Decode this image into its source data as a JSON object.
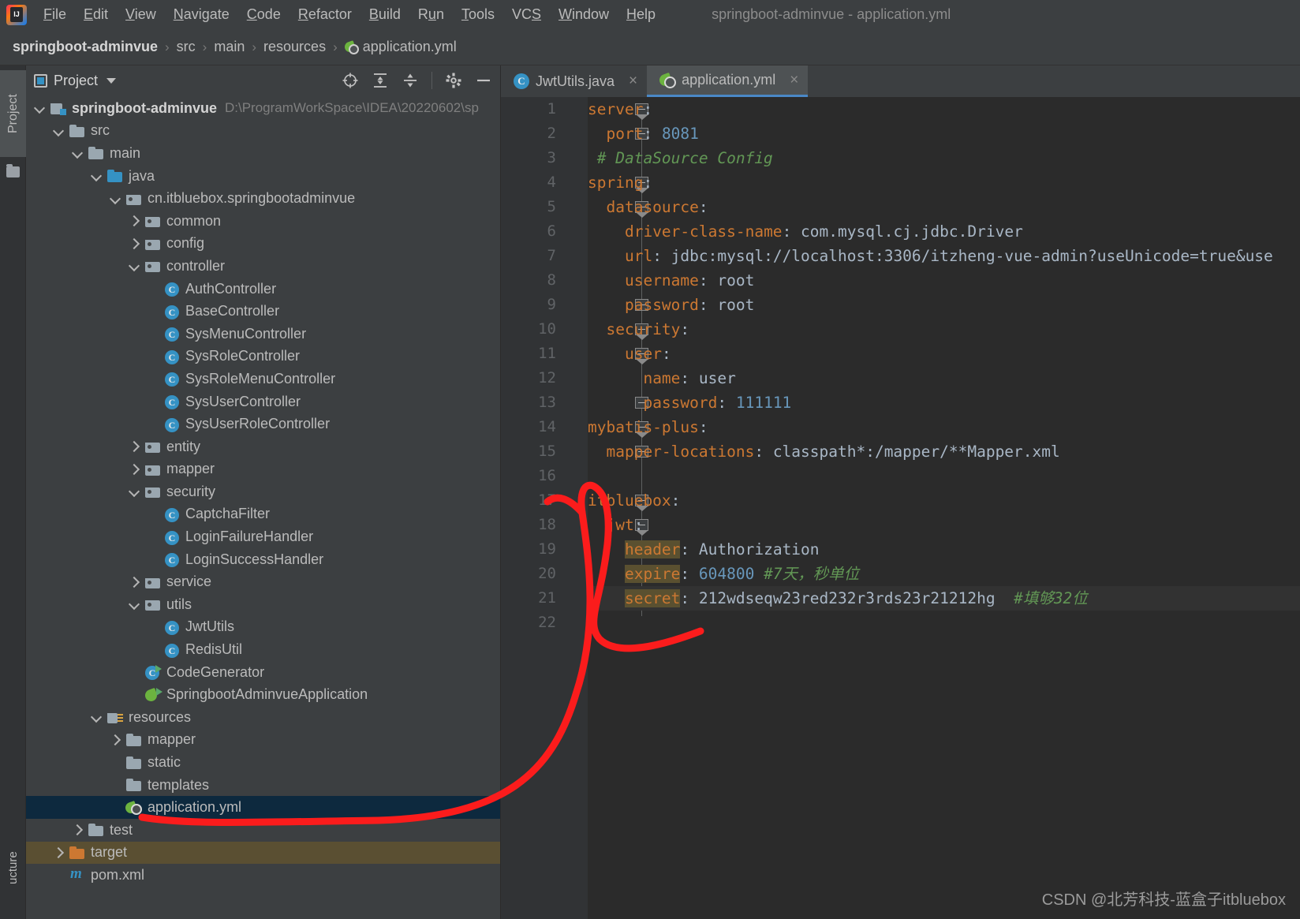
{
  "window": {
    "title": "springboot-adminvue - application.yml",
    "logo_icon": "intellij-idea-logo"
  },
  "menubar": {
    "items": [
      {
        "label": "File",
        "mnemonic": "F"
      },
      {
        "label": "Edit",
        "mnemonic": "E"
      },
      {
        "label": "View",
        "mnemonic": "V"
      },
      {
        "label": "Navigate",
        "mnemonic": "N"
      },
      {
        "label": "Code",
        "mnemonic": "C"
      },
      {
        "label": "Refactor",
        "mnemonic": "R"
      },
      {
        "label": "Build",
        "mnemonic": "B"
      },
      {
        "label": "Run",
        "mnemonic": "u"
      },
      {
        "label": "Tools",
        "mnemonic": "T"
      },
      {
        "label": "VCS",
        "mnemonic": "S"
      },
      {
        "label": "Window",
        "mnemonic": "W"
      },
      {
        "label": "Help",
        "mnemonic": "H"
      }
    ]
  },
  "breadcrumb": {
    "separator": "›",
    "items": [
      "springboot-adminvue",
      "src",
      "main",
      "resources",
      "application.yml"
    ],
    "file_icon": "yaml-spring-icon"
  },
  "left_strip": {
    "project_tab": "Project",
    "bottom_tab": "ucture",
    "folder_icon": "folder-icon"
  },
  "project_panel": {
    "title": "Project",
    "dropdown_icon": "chevron-down-icon",
    "toolbar_icons": [
      "select-opened-file-icon",
      "expand-all-icon",
      "collapse-all-icon",
      "settings-gear-icon",
      "hide-panel-icon"
    ],
    "tree": [
      {
        "label": "springboot-adminvue",
        "path": "D:\\ProgramWorkSpace\\IDEA\\20220602\\sp",
        "depth": 0,
        "arrow": "open",
        "icon": "module-root-icon",
        "bold": true
      },
      {
        "label": "src",
        "depth": 1,
        "arrow": "open",
        "icon": "folder-icon"
      },
      {
        "label": "main",
        "depth": 2,
        "arrow": "open",
        "icon": "folder-icon"
      },
      {
        "label": "java",
        "depth": 3,
        "arrow": "open",
        "icon": "source-root-folder-icon"
      },
      {
        "label": "cn.itbluebox.springbootadminvue",
        "depth": 4,
        "arrow": "open",
        "icon": "package-icon"
      },
      {
        "label": "common",
        "depth": 5,
        "arrow": "closed",
        "icon": "package-icon"
      },
      {
        "label": "config",
        "depth": 5,
        "arrow": "closed",
        "icon": "package-icon"
      },
      {
        "label": "controller",
        "depth": 5,
        "arrow": "open",
        "icon": "package-icon"
      },
      {
        "label": "AuthController",
        "depth": 6,
        "arrow": "none",
        "icon": "java-class-icon"
      },
      {
        "label": "BaseController",
        "depth": 6,
        "arrow": "none",
        "icon": "java-class-icon"
      },
      {
        "label": "SysMenuController",
        "depth": 6,
        "arrow": "none",
        "icon": "java-class-icon"
      },
      {
        "label": "SysRoleController",
        "depth": 6,
        "arrow": "none",
        "icon": "java-class-icon"
      },
      {
        "label": "SysRoleMenuController",
        "depth": 6,
        "arrow": "none",
        "icon": "java-class-icon"
      },
      {
        "label": "SysUserController",
        "depth": 6,
        "arrow": "none",
        "icon": "java-class-icon"
      },
      {
        "label": "SysUserRoleController",
        "depth": 6,
        "arrow": "none",
        "icon": "java-class-icon"
      },
      {
        "label": "entity",
        "depth": 5,
        "arrow": "closed",
        "icon": "package-icon"
      },
      {
        "label": "mapper",
        "depth": 5,
        "arrow": "closed",
        "icon": "package-icon"
      },
      {
        "label": "security",
        "depth": 5,
        "arrow": "open",
        "icon": "package-icon"
      },
      {
        "label": "CaptchaFilter",
        "depth": 6,
        "arrow": "none",
        "icon": "java-class-icon"
      },
      {
        "label": "LoginFailureHandler",
        "depth": 6,
        "arrow": "none",
        "icon": "java-class-icon"
      },
      {
        "label": "LoginSuccessHandler",
        "depth": 6,
        "arrow": "none",
        "icon": "java-class-icon"
      },
      {
        "label": "service",
        "depth": 5,
        "arrow": "closed",
        "icon": "package-icon"
      },
      {
        "label": "utils",
        "depth": 5,
        "arrow": "open",
        "icon": "package-icon"
      },
      {
        "label": "JwtUtils",
        "depth": 6,
        "arrow": "none",
        "icon": "java-class-icon"
      },
      {
        "label": "RedisUtil",
        "depth": 6,
        "arrow": "none",
        "icon": "java-class-icon"
      },
      {
        "label": "CodeGenerator",
        "depth": 5,
        "arrow": "none",
        "icon": "runnable-class-icon"
      },
      {
        "label": "SpringbootAdminvueApplication",
        "depth": 5,
        "arrow": "none",
        "icon": "spring-boot-runnable-icon"
      },
      {
        "label": "resources",
        "depth": 3,
        "arrow": "open",
        "icon": "resource-root-folder-icon"
      },
      {
        "label": "mapper",
        "depth": 4,
        "arrow": "closed",
        "icon": "folder-icon"
      },
      {
        "label": "static",
        "depth": 4,
        "arrow": "none",
        "icon": "folder-icon"
      },
      {
        "label": "templates",
        "depth": 4,
        "arrow": "none",
        "icon": "folder-icon"
      },
      {
        "label": "application.yml",
        "depth": 4,
        "arrow": "none",
        "icon": "yaml-spring-icon",
        "state": "selected"
      },
      {
        "label": "test",
        "depth": 2,
        "arrow": "closed",
        "icon": "folder-icon"
      },
      {
        "label": "target",
        "depth": 1,
        "arrow": "closed",
        "icon": "folder-excluded-icon",
        "state": "highlight"
      },
      {
        "label": "pom.xml",
        "depth": 1,
        "arrow": "none",
        "icon": "maven-icon"
      }
    ]
  },
  "editor": {
    "tabs": [
      {
        "label": "JwtUtils.java",
        "icon": "java-class-icon",
        "active": false,
        "close": "×"
      },
      {
        "label": "application.yml",
        "icon": "yaml-spring-icon",
        "active": true,
        "close": "×"
      }
    ],
    "file_name": "application.yml",
    "lines": [
      {
        "num": 1,
        "fold": "down",
        "tokens": [
          {
            "t": "server",
            "c": "k-key"
          },
          {
            "t": ":",
            "c": "k-pun"
          }
        ]
      },
      {
        "num": 2,
        "fold": "end",
        "tokens": [
          {
            "t": "  ",
            "c": "k-pun"
          },
          {
            "t": "port",
            "c": "k-key"
          },
          {
            "t": ": ",
            "c": "k-pun"
          },
          {
            "t": "8081",
            "c": "k-num"
          }
        ]
      },
      {
        "num": 3,
        "fold": "",
        "tokens": [
          {
            "t": " # DataSource Config",
            "c": "k-com"
          }
        ]
      },
      {
        "num": 4,
        "fold": "down",
        "tokens": [
          {
            "t": "spring",
            "c": "k-key"
          },
          {
            "t": ":",
            "c": "k-pun"
          }
        ]
      },
      {
        "num": 5,
        "fold": "down",
        "tokens": [
          {
            "t": "  ",
            "c": "k-pun"
          },
          {
            "t": "datasource",
            "c": "k-key"
          },
          {
            "t": ":",
            "c": "k-pun"
          }
        ]
      },
      {
        "num": 6,
        "fold": "",
        "tokens": [
          {
            "t": "    ",
            "c": "k-pun"
          },
          {
            "t": "driver-class-name",
            "c": "k-key"
          },
          {
            "t": ": ",
            "c": "k-pun"
          },
          {
            "t": "com.mysql.cj.jdbc.Driver",
            "c": "k-str"
          }
        ]
      },
      {
        "num": 7,
        "fold": "",
        "tokens": [
          {
            "t": "    ",
            "c": "k-pun"
          },
          {
            "t": "url",
            "c": "k-key"
          },
          {
            "t": ": ",
            "c": "k-pun"
          },
          {
            "t": "jdbc:mysql://localhost:3306/itzheng-vue-admin?useUnicode=true&use",
            "c": "k-str"
          }
        ]
      },
      {
        "num": 8,
        "fold": "",
        "tokens": [
          {
            "t": "    ",
            "c": "k-pun"
          },
          {
            "t": "username",
            "c": "k-key"
          },
          {
            "t": ": ",
            "c": "k-pun"
          },
          {
            "t": "root",
            "c": "k-str"
          }
        ]
      },
      {
        "num": 9,
        "fold": "end",
        "tokens": [
          {
            "t": "    ",
            "c": "k-pun"
          },
          {
            "t": "password",
            "c": "k-key"
          },
          {
            "t": ": ",
            "c": "k-pun"
          },
          {
            "t": "root",
            "c": "k-str"
          }
        ]
      },
      {
        "num": 10,
        "fold": "down",
        "tokens": [
          {
            "t": "  ",
            "c": "k-pun"
          },
          {
            "t": "security",
            "c": "k-key"
          },
          {
            "t": ":",
            "c": "k-pun"
          }
        ]
      },
      {
        "num": 11,
        "fold": "down",
        "tokens": [
          {
            "t": "    ",
            "c": "k-pun"
          },
          {
            "t": "user",
            "c": "k-key"
          },
          {
            "t": ":",
            "c": "k-pun"
          }
        ]
      },
      {
        "num": 12,
        "fold": "",
        "tokens": [
          {
            "t": "      ",
            "c": "k-pun"
          },
          {
            "t": "name",
            "c": "k-key"
          },
          {
            "t": ": ",
            "c": "k-pun"
          },
          {
            "t": "user",
            "c": "k-str"
          }
        ]
      },
      {
        "num": 13,
        "fold": "end",
        "tokens": [
          {
            "t": "      ",
            "c": "k-pun"
          },
          {
            "t": "password",
            "c": "k-key"
          },
          {
            "t": ": ",
            "c": "k-pun"
          },
          {
            "t": "111111",
            "c": "k-num"
          }
        ]
      },
      {
        "num": 14,
        "fold": "down",
        "tokens": [
          {
            "t": "mybatis-plus",
            "c": "k-key"
          },
          {
            "t": ":",
            "c": "k-pun"
          }
        ]
      },
      {
        "num": 15,
        "fold": "end",
        "tokens": [
          {
            "t": "  ",
            "c": "k-pun"
          },
          {
            "t": "mapper-locations",
            "c": "k-key"
          },
          {
            "t": ": ",
            "c": "k-pun"
          },
          {
            "t": "classpath*:/mapper/**Mapper.xml",
            "c": "k-str"
          }
        ]
      },
      {
        "num": 16,
        "fold": "",
        "tokens": []
      },
      {
        "num": 17,
        "fold": "down",
        "tokens": [
          {
            "t": "itbluebox",
            "c": "k-key"
          },
          {
            "t": ":",
            "c": "k-pun"
          }
        ]
      },
      {
        "num": 18,
        "fold": "down",
        "tokens": [
          {
            "t": "  ",
            "c": "k-pun"
          },
          {
            "t": "jwt",
            "c": "k-key"
          },
          {
            "t": ":",
            "c": "k-pun"
          }
        ]
      },
      {
        "num": 19,
        "fold": "",
        "tokens": [
          {
            "t": "    ",
            "c": "k-pun"
          },
          {
            "t": "header",
            "c": "k-key hl-key"
          },
          {
            "t": ": ",
            "c": "k-pun"
          },
          {
            "t": "Authorization",
            "c": "k-str"
          }
        ]
      },
      {
        "num": 20,
        "fold": "",
        "tokens": [
          {
            "t": "    ",
            "c": "k-pun"
          },
          {
            "t": "expire",
            "c": "k-key hl-key"
          },
          {
            "t": ": ",
            "c": "k-pun"
          },
          {
            "t": "604800",
            "c": "k-num"
          },
          {
            "t": " #7天，秒单位",
            "c": "k-com"
          }
        ]
      },
      {
        "num": 21,
        "fold": "end",
        "highlight": true,
        "tokens": [
          {
            "t": "    ",
            "c": "k-pun"
          },
          {
            "t": "secret",
            "c": "k-key hl-key"
          },
          {
            "t": ": ",
            "c": "k-pun"
          },
          {
            "t": "212wdseqw23red232r3rds23r21212hg",
            "c": "k-str"
          },
          {
            "t": "  #填够32位",
            "c": "k-com"
          }
        ]
      },
      {
        "num": 22,
        "fold": "",
        "tokens": []
      }
    ]
  },
  "annotation": {
    "type": "red-arrow-annotation",
    "color": "#fb1c1c",
    "description": "hand-drawn red arrow from application.yml in tree to itbluebox jwt block"
  },
  "watermark": {
    "text": "CSDN @北芳科技-蓝盒子itbluebox"
  },
  "colors": {
    "editor_bg": "#2b2b2b",
    "panel_bg": "#3c3f41",
    "gutter_bg": "#313335",
    "selection_blue": "#0d293e",
    "accent_blue": "#3592c4",
    "key_orange": "#cc7832",
    "comment_green": "#629755",
    "number_blue": "#6897bb",
    "annotation_red": "#fb1c1c",
    "highlight_yellow": "#5a5030"
  }
}
